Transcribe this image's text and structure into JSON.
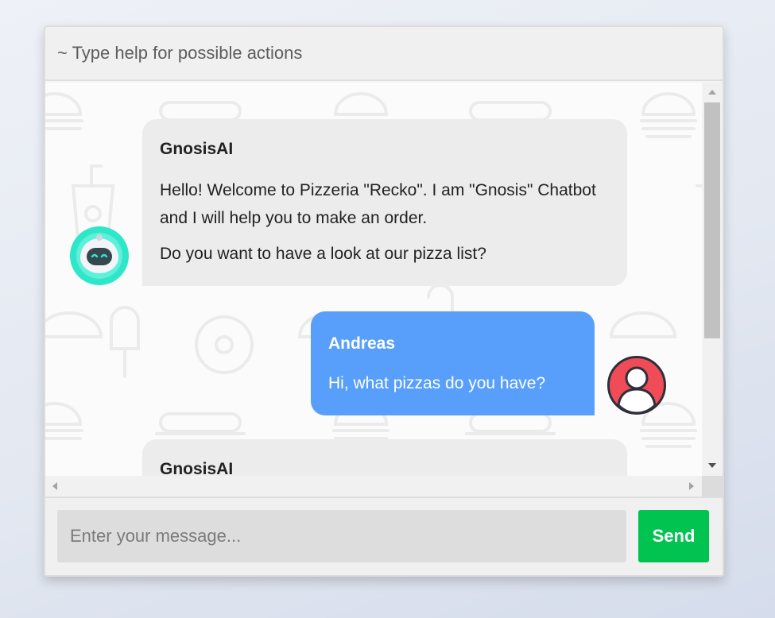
{
  "header": {
    "hint": "~ Type help for possible actions"
  },
  "messages": [
    {
      "sender": "GnosisAI",
      "lines": [
        "Hello! Welcome to Pizzeria \"Recko\". I am \"Gnosis\" Chatbot and I will help you to make an order.",
        "Do you want to have a look at our pizza list?"
      ]
    },
    {
      "sender": "Andreas",
      "lines": [
        "Hi, what pizzas do you have?"
      ]
    },
    {
      "sender": "GnosisAI",
      "lines": []
    }
  ],
  "composer": {
    "placeholder": "Enter your message...",
    "send_label": "Send"
  },
  "colors": {
    "bot_bubble": "#ececec",
    "user_bubble": "#579ffb",
    "send_button": "#00c44f",
    "user_avatar": "#ef4c58",
    "bot_avatar": "#2ee6c8"
  },
  "icons": {
    "bot_avatar": "robot-avatar-icon",
    "user_avatar": "user-avatar-icon",
    "background": "food-pattern"
  }
}
